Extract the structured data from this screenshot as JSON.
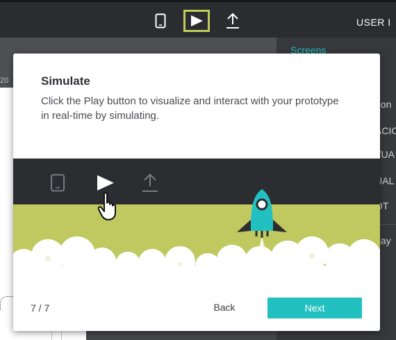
{
  "toolbar": {
    "icons": [
      "device-icon",
      "play-icon",
      "upload-icon"
    ],
    "user_label": "USER I",
    "active_color": "#c0cd5a"
  },
  "background": {
    "left_number": "20",
    "right_panel": {
      "tab": "Screens",
      "labels": [
        "hon",
        "ACIO",
        "TUA",
        "UAL",
        "OT",
        "Lay"
      ]
    }
  },
  "modal": {
    "title": "Simulate",
    "description": "Click the Play button to visualize and interact with your prototype in real-time by simulating.",
    "step": "7 / 7",
    "back_label": "Back",
    "next_label": "Next",
    "colors": {
      "accent": "#22c0c0",
      "illustration_green": "#bfc95f",
      "illustration_dark": "#2c2d31"
    }
  }
}
